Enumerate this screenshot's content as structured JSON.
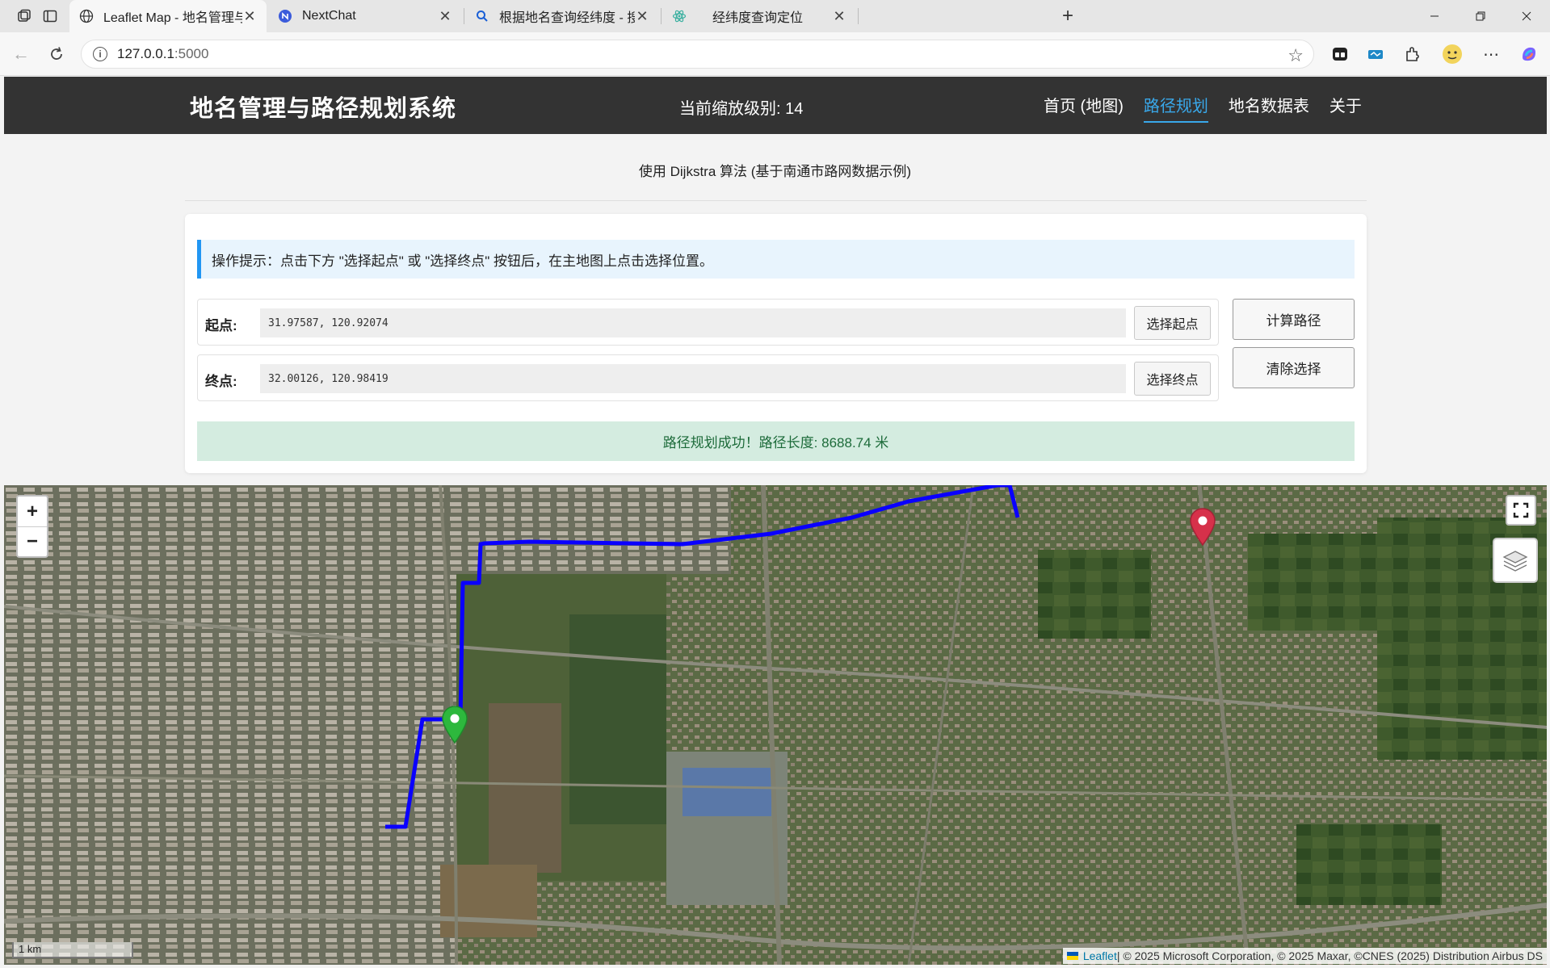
{
  "browser": {
    "tabs": [
      {
        "title": "Leaflet Map - 地名管理与路径规划",
        "active": true
      },
      {
        "title": "NextChat",
        "active": false
      },
      {
        "title": "根据地名查询经纬度 - 搜索",
        "active": false
      },
      {
        "title": "经纬度查询定位",
        "active": false
      }
    ],
    "url_host": "127.0.0.1",
    "url_port": ":5000"
  },
  "header": {
    "title": "地名管理与路径规划系统",
    "zoom_text": "当前缩放级别: 14",
    "nav": [
      {
        "label": "首页 (地图)",
        "active": false
      },
      {
        "label": "路径规划",
        "active": true
      },
      {
        "label": "地名数据表",
        "active": false
      },
      {
        "label": "关于",
        "active": false
      }
    ]
  },
  "main": {
    "subtitle": "使用 Dijkstra 算法 (基于南通市路网数据示例)",
    "tip": "操作提示：点击下方 \"选择起点\" 或 \"选择终点\" 按钮后，在主地图上点击选择位置。",
    "start": {
      "label": "起点:",
      "value": "31.97587, 120.92074",
      "button": "选择起点"
    },
    "end": {
      "label": "终点:",
      "value": "32.00126, 120.98419",
      "button": "选择终点"
    },
    "calc_button": "计算路径",
    "clear_button": "清除选择",
    "result": "路径规划成功！路径长度: 8688.74 米"
  },
  "map": {
    "zoom_in": "+",
    "zoom_out": "−",
    "scale_label": "1 km",
    "attribution_leaflet": "Leaflet",
    "attribution_rest": " | © 2025 Microsoft Corporation, © 2025 Maxar, ©CNES (2025) Distribution Airbus DS",
    "route_color": "#0a00ff",
    "start_marker_color": "#2db83d",
    "end_marker_color": "#d6314a"
  }
}
